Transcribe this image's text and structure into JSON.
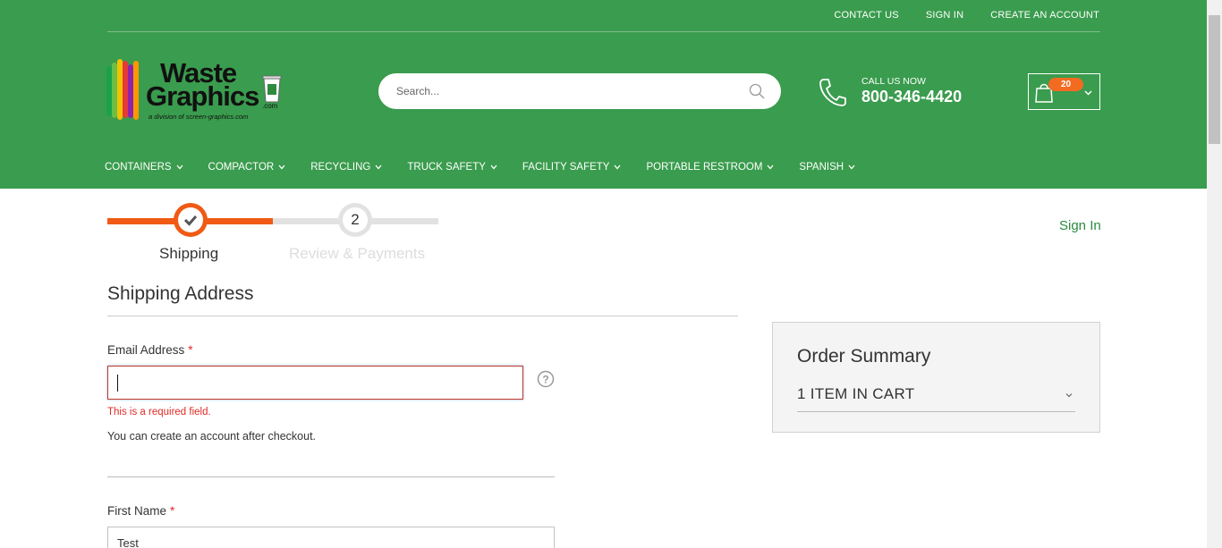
{
  "top_links": [
    "CONTACT US",
    "SIGN IN",
    "CREATE AN ACCOUNT"
  ],
  "logo": {
    "word1": "Waste",
    "word2": "Graphics",
    "com": ".com",
    "tagline": "a division of screen-graphics.com",
    "bar_colors": [
      "#1aa34a",
      "#6cbe45",
      "#f2c200",
      "#e53935",
      "#8e24aa",
      "#ff9800"
    ]
  },
  "search": {
    "placeholder": "Search..."
  },
  "call": {
    "label": "CALL US NOW",
    "number": "800-346-4420"
  },
  "cart": {
    "count": "20"
  },
  "nav": [
    "CONTAINERS",
    "COMPACTOR",
    "RECYCLING",
    "TRUCK SAFETY",
    "FACILITY SAFETY",
    "PORTABLE RESTROOM",
    "SPANISH"
  ],
  "progress": {
    "step1_label": "Shipping",
    "step2_number": "2",
    "step2_label": "Review & Payments"
  },
  "sign_in_link": "Sign In",
  "shipping": {
    "title": "Shipping Address",
    "email_label": "Email Address",
    "required_mark": "*",
    "email_value": "",
    "error": "This is a required field.",
    "note": "You can create an account after checkout.",
    "first_name_label": "First Name",
    "first_name_value": "Test"
  },
  "order_summary": {
    "title": "Order Summary",
    "items": "1 ITEM IN CART"
  },
  "colors": {
    "header_green": "#3a9c4e",
    "accent_orange": "#f05a14",
    "error_red": "#e02b27",
    "link_green": "#2a8a40"
  }
}
